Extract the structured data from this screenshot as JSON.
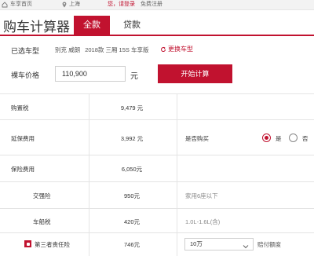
{
  "topbar": {
    "home_link": "车享首页",
    "city": "上海",
    "greeting": "您，请登录",
    "register": "免费注册"
  },
  "header": {
    "title": "购车计算器",
    "tabs": [
      {
        "label": "全款",
        "active": true
      },
      {
        "label": "贷款",
        "active": false
      }
    ]
  },
  "selected_car": {
    "label": "已选车型",
    "brand": "别克 威朗",
    "model": "2018款 三厢 15S 车享版",
    "change_label": "更换车型"
  },
  "price": {
    "label": "裸车价格",
    "value": "110,900",
    "unit": "元",
    "calc_button": "开始计算"
  },
  "rows": {
    "purchase_tax": {
      "label": "购置税",
      "value": "9,479 元"
    },
    "extended_warranty": {
      "label": "延保费用",
      "value": "3,992 元",
      "question": "是否购买",
      "options": [
        "是",
        "否"
      ],
      "selected": "是"
    },
    "insurance": {
      "label": "保险费用",
      "value": "6,050元"
    },
    "compulsory": {
      "label": "交强险",
      "value": "950元",
      "note": "家用6座以下"
    },
    "vehicle_tax": {
      "label": "车船税",
      "value": "420元",
      "note": "1.0L-1.6L(含)"
    },
    "third_party": {
      "label": "第三者责任险",
      "value": "746元",
      "checked": true,
      "select_value": "10万",
      "suffix": "赔付额度"
    }
  },
  "colors": {
    "accent": "#c1122f",
    "grid": "#e4e4e4"
  }
}
